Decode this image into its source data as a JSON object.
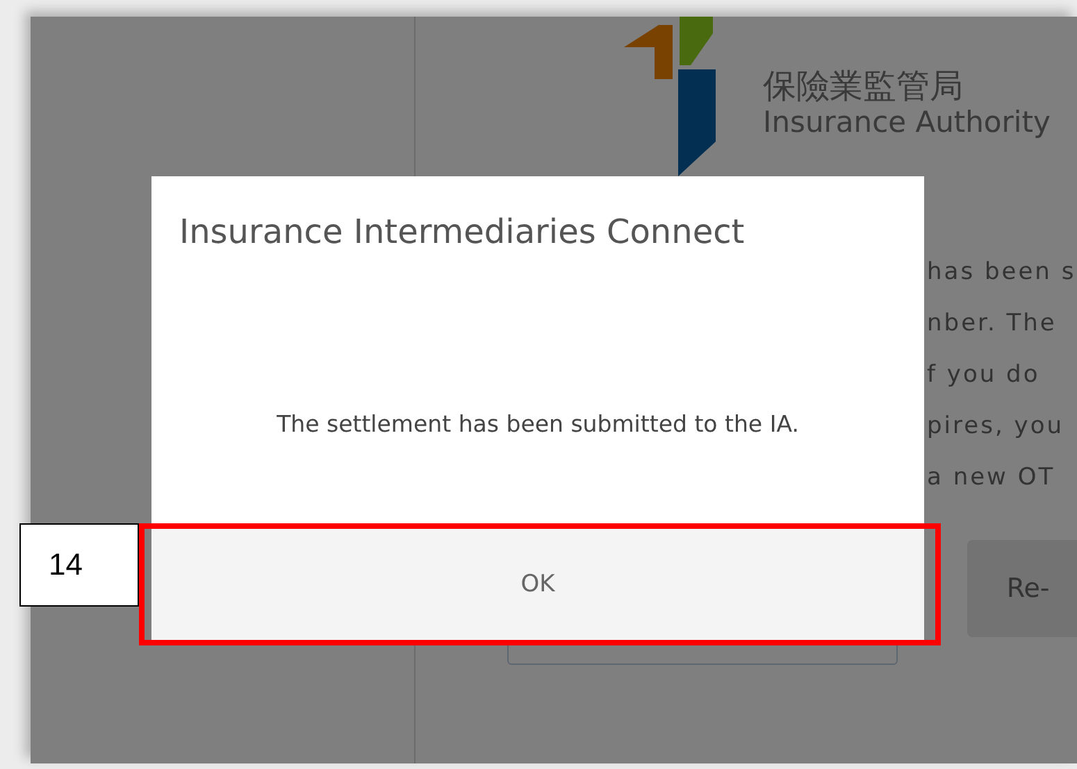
{
  "background": {
    "logo": {
      "chinese": "保險業監管局",
      "english": "Insurance Authority"
    },
    "text_lines": [
      "has been s",
      "nber. The",
      "f you do",
      "pires, you",
      "a new OT"
    ],
    "resend_button": "Re-"
  },
  "dialog": {
    "title": "Insurance Intermediaries Connect",
    "message": "The settlement has been submitted to the IA.",
    "button": "OK"
  },
  "annotation": {
    "label": "14"
  }
}
